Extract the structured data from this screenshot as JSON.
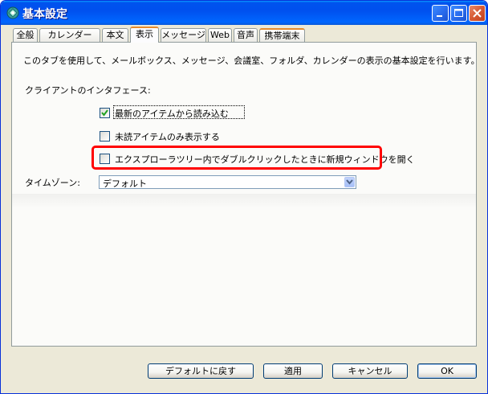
{
  "window": {
    "title": "基本設定"
  },
  "tabs": [
    {
      "label": "全般"
    },
    {
      "label": "カレンダー"
    },
    {
      "label": "本文"
    },
    {
      "label": "表示"
    },
    {
      "label": "メッセージ"
    },
    {
      "label": "Web"
    },
    {
      "label": "音声"
    },
    {
      "label": "携帯端末"
    }
  ],
  "active_tab": "表示",
  "content": {
    "description": "このタブを使用して、メールボックス、メッセージ、会議室、フォルダ、カレンダーの表示の基本設定を行います。",
    "client_interface_label": "クライアントのインタフェース:",
    "checkboxes": [
      {
        "label": "最新のアイテムから読み込む",
        "checked": true
      },
      {
        "label": "未読アイテムのみ表示する",
        "checked": false
      },
      {
        "label": "エクスプローラツリー内でダブルクリックしたときに新規ウィンドウを開く",
        "checked": false
      }
    ],
    "timezone": {
      "label": "タイムゾーン:",
      "value": "デフォルト"
    }
  },
  "buttons": {
    "reset": "デフォルトに戻す",
    "apply": "適用",
    "cancel": "キャンセル",
    "ok": "OK"
  },
  "colors": {
    "highlight": "#ff0000",
    "titlebar": "#0058ee",
    "tab_accent": "#e68b2c"
  }
}
